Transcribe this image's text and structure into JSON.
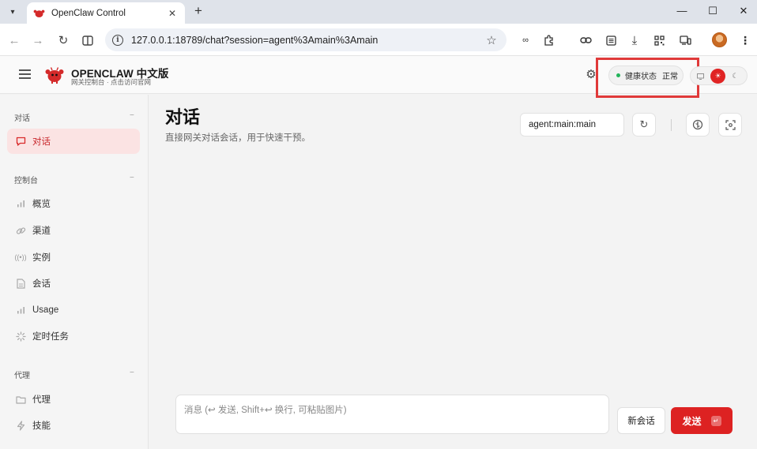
{
  "browser": {
    "tab_title": "OpenClaw Control",
    "tab_close": "✕",
    "new_tab": "+",
    "url": "127.0.0.1:18789/chat?session=agent%3Amain%3Amain",
    "window_controls": [
      "—",
      "☐",
      "✕"
    ]
  },
  "app": {
    "brand": "OPENCLAW 中文版",
    "brand_sub": "网关控制台 · 点击访问官网",
    "health_label": "健康状态",
    "health_value": "正常",
    "health_color": "#22b45a",
    "accent_color": "#dd2222"
  },
  "sidebar": {
    "sections": [
      {
        "title": "对话",
        "collapse": "−"
      },
      {
        "title": "控制台",
        "collapse": "−"
      },
      {
        "title": "代理",
        "collapse": "−"
      }
    ],
    "items": [
      {
        "label": "对话",
        "icon": "chat-icon",
        "active": true
      },
      {
        "label": "概览",
        "icon": "bar-chart-icon"
      },
      {
        "label": "渠道",
        "icon": "link-icon"
      },
      {
        "label": "实例",
        "icon": "broadcast-icon"
      },
      {
        "label": "会话",
        "icon": "document-icon"
      },
      {
        "label": "Usage",
        "icon": "bar-chart-icon"
      },
      {
        "label": "定时任务",
        "icon": "loader-icon"
      },
      {
        "label": "代理",
        "icon": "folder-icon"
      },
      {
        "label": "技能",
        "icon": "bolt-icon"
      }
    ]
  },
  "main": {
    "title": "对话",
    "subtitle": "直接网关对话会话，用于快速干预。",
    "session_value": "agent:main:main",
    "composer_placeholder": "消息 (↩ 发送, Shift+↩ 换行, 可粘贴图片)",
    "new_session_label": "新会话",
    "send_label": "发送",
    "send_key": "↵"
  }
}
